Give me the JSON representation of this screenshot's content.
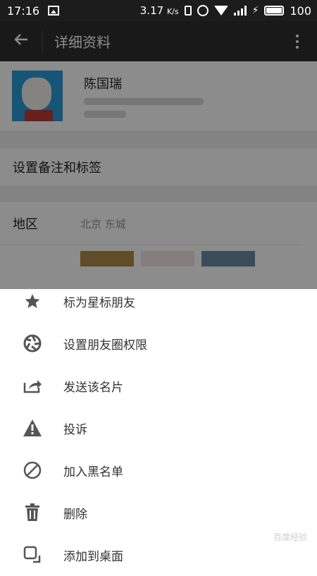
{
  "status_bar": {
    "time": "17:16",
    "speed": "3.17",
    "speed_unit": "K/s",
    "battery": "100"
  },
  "app_bar": {
    "title": "详细资料"
  },
  "profile": {
    "name": "陈国瑞"
  },
  "actions": {
    "remark_tags": "设置备注和标签"
  },
  "region": {
    "label": "地区",
    "value": "北京  东城"
  },
  "menu": {
    "items": [
      {
        "label": "标为星标朋友",
        "icon": "star-icon"
      },
      {
        "label": "设置朋友圈权限",
        "icon": "aperture-icon"
      },
      {
        "label": "发送该名片",
        "icon": "share-icon"
      },
      {
        "label": "投诉",
        "icon": "warning-icon"
      },
      {
        "label": "加入黑名单",
        "icon": "block-icon"
      },
      {
        "label": "删除",
        "icon": "trash-icon"
      },
      {
        "label": "添加到桌面",
        "icon": "add-to-desktop-icon"
      }
    ]
  },
  "watermark": "百度经验"
}
